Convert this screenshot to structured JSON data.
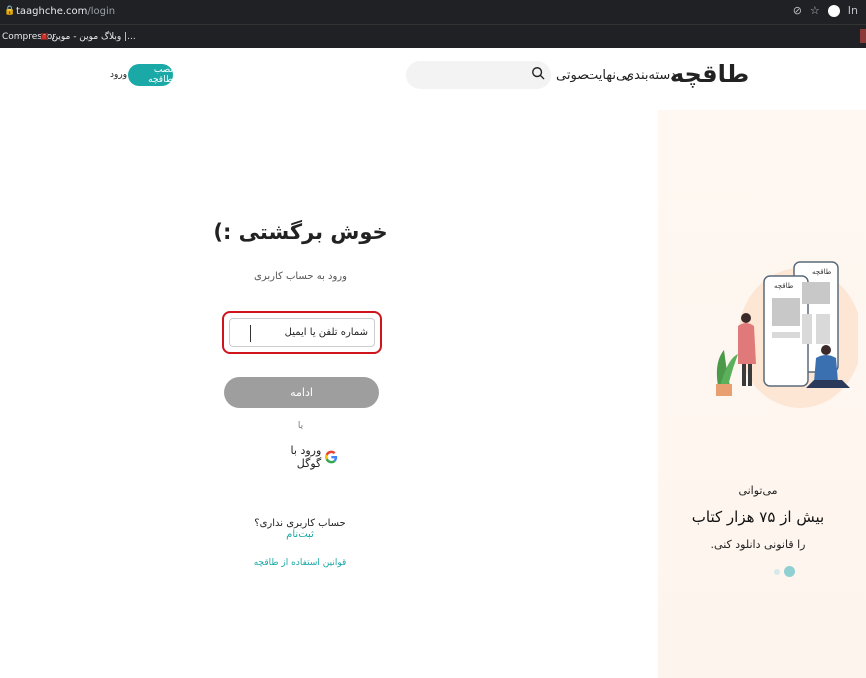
{
  "browser": {
    "url_host": "taaghche.com",
    "url_path": "/login",
    "profile_letter": "In",
    "bookmarks": [
      {
        "label": "Compressor"
      },
      {
        "label": "وبلاگ موین - موین |..."
      }
    ]
  },
  "header": {
    "logo": "طاقچه",
    "nav": {
      "categories": "دسته‌بندی",
      "unlimited": "بی‌نهایت",
      "audio": "صوتی"
    },
    "search_placeholder": "",
    "install_button": "نصب طاقچه",
    "login_link": "ورود"
  },
  "login": {
    "title": "خوش برگشتی :)",
    "subtitle": "ورود به حساب کاربری",
    "input_placeholder": "شماره تلفن یا ایمیل",
    "input_value": "",
    "continue_button": "ادامه",
    "or_text": "یا",
    "google_button": "ورود با گوگل",
    "no_account_text": "حساب کاربری نداری؟",
    "signup_link": "ثبت‌نام",
    "terms_link": "قوانین استفاده از طاقچه"
  },
  "promo": {
    "line1": "می‌توانی",
    "line2": "بیش از ۷۵ هزار کتاب",
    "line3": "را قانونی دانلود کنی.",
    "illustration_label": "طاقچه",
    "carousel_active_index": 1,
    "carousel_count": 2
  },
  "colors": {
    "accent": "#1aa9a6",
    "error_outline": "#d0141c",
    "button_disabled": "#9e9e9e"
  }
}
